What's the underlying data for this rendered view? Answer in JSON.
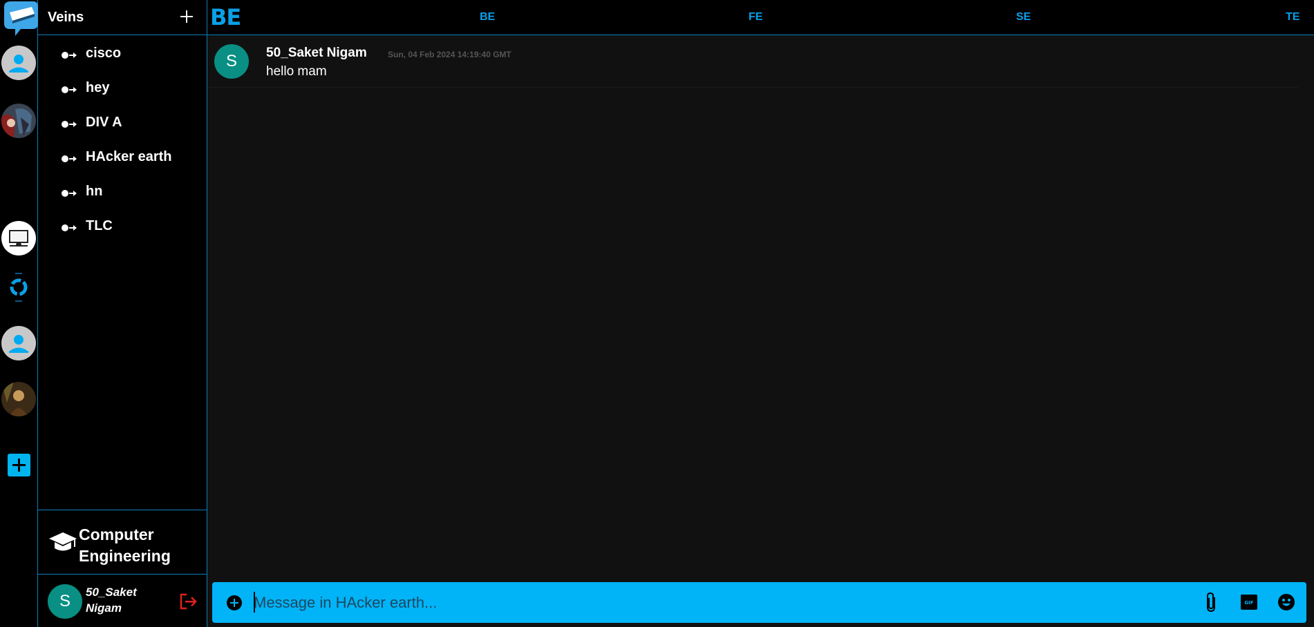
{
  "sidebar": {
    "title": "Veins",
    "channels": [
      {
        "label": "cisco"
      },
      {
        "label": "hey"
      },
      {
        "label": "DIV A"
      },
      {
        "label": "HAcker earth"
      },
      {
        "label": "hn"
      },
      {
        "label": "TLC"
      }
    ],
    "department": "Computer Engineering",
    "user": {
      "initial": "S",
      "name": "50_Saket Nigam"
    }
  },
  "topbar": {
    "brand": "BE",
    "tabs": [
      "BE",
      "FE",
      "SE",
      "TE"
    ]
  },
  "messages": [
    {
      "initial": "S",
      "author": "50_Saket Nigam",
      "time": "Sun, 04 Feb 2024 14:19:40 GMT",
      "text": "hello mam"
    }
  ],
  "composer": {
    "placeholder": "Message in HAcker earth..."
  },
  "colors": {
    "accent": "#00b4f7",
    "border": "#0b80b8",
    "avatar": "#098f84",
    "logout": "#e02020"
  },
  "icons": {
    "logo": "chat-bubble-logo-icon",
    "add_channel": "plus-icon",
    "channel": "channel-arrow-icon",
    "department": "graduation-cap-icon",
    "logout": "logout-icon",
    "attach": "paperclip-icon",
    "gif": "gif-icon",
    "emoji": "emoji-icon",
    "add_attachment": "plus-circle-icon"
  }
}
